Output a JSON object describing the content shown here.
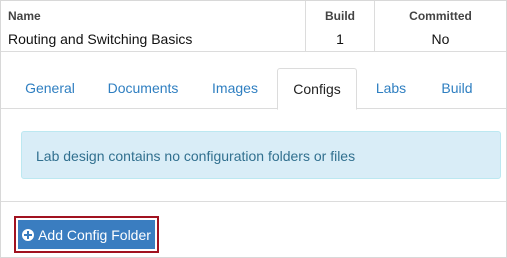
{
  "summary": {
    "name_header": "Name",
    "name_value": "Routing and Switching Basics",
    "build_header": "Build",
    "build_value": "1",
    "committed_header": "Committed",
    "committed_value": "No"
  },
  "tabs": [
    {
      "label": "General"
    },
    {
      "label": "Documents"
    },
    {
      "label": "Images"
    },
    {
      "label": "Configs",
      "active": true
    },
    {
      "label": "Labs"
    },
    {
      "label": "Build"
    }
  ],
  "alert": {
    "message": "Lab design contains no configuration folders or files"
  },
  "actions": {
    "add_config_folder_label": "Add Config Folder",
    "add_icon": "plus-circle-icon"
  },
  "colors": {
    "link": "#2f7fc1",
    "alert_bg": "#d9edf7",
    "alert_text": "#31708f",
    "button_bg": "#3a7dc0",
    "highlight_border": "#a11220"
  }
}
